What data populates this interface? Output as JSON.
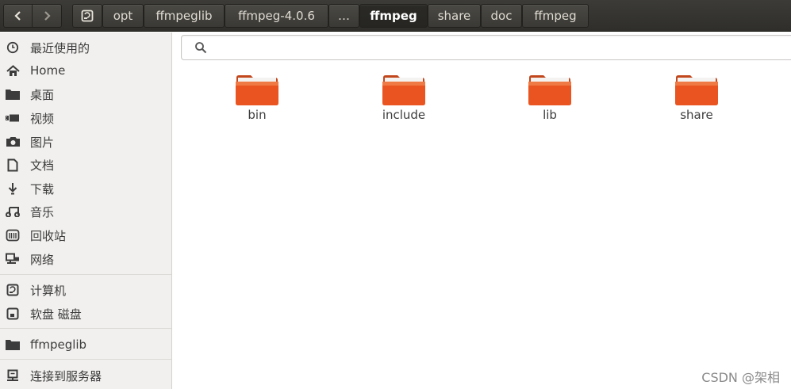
{
  "header": {
    "breadcrumbs": [
      "opt",
      "ffmpeglib",
      "ffmpeg-4.0.6",
      "…",
      "ffmpeg",
      "share",
      "doc",
      "ffmpeg"
    ]
  },
  "sidebar": {
    "recent": "最近使用的",
    "home": "Home",
    "desktop": "桌面",
    "videos": "视频",
    "pictures": "图片",
    "documents": "文档",
    "downloads": "下载",
    "music": "音乐",
    "trash": "回收站",
    "network": "网络",
    "computer": "计算机",
    "floppy": "软盘 磁盘",
    "bookmark": "ffmpeglib",
    "connect": "连接到服务器"
  },
  "search": {
    "value": "",
    "placeholder": ""
  },
  "files": {
    "items": [
      "bin",
      "include",
      "lib",
      "share"
    ]
  },
  "watermark": "CSDN @架相",
  "colors": {
    "header_bg": "#3c3b37",
    "folder_orange": "#e95420",
    "sidebar_bg": "#f1f0ee"
  }
}
